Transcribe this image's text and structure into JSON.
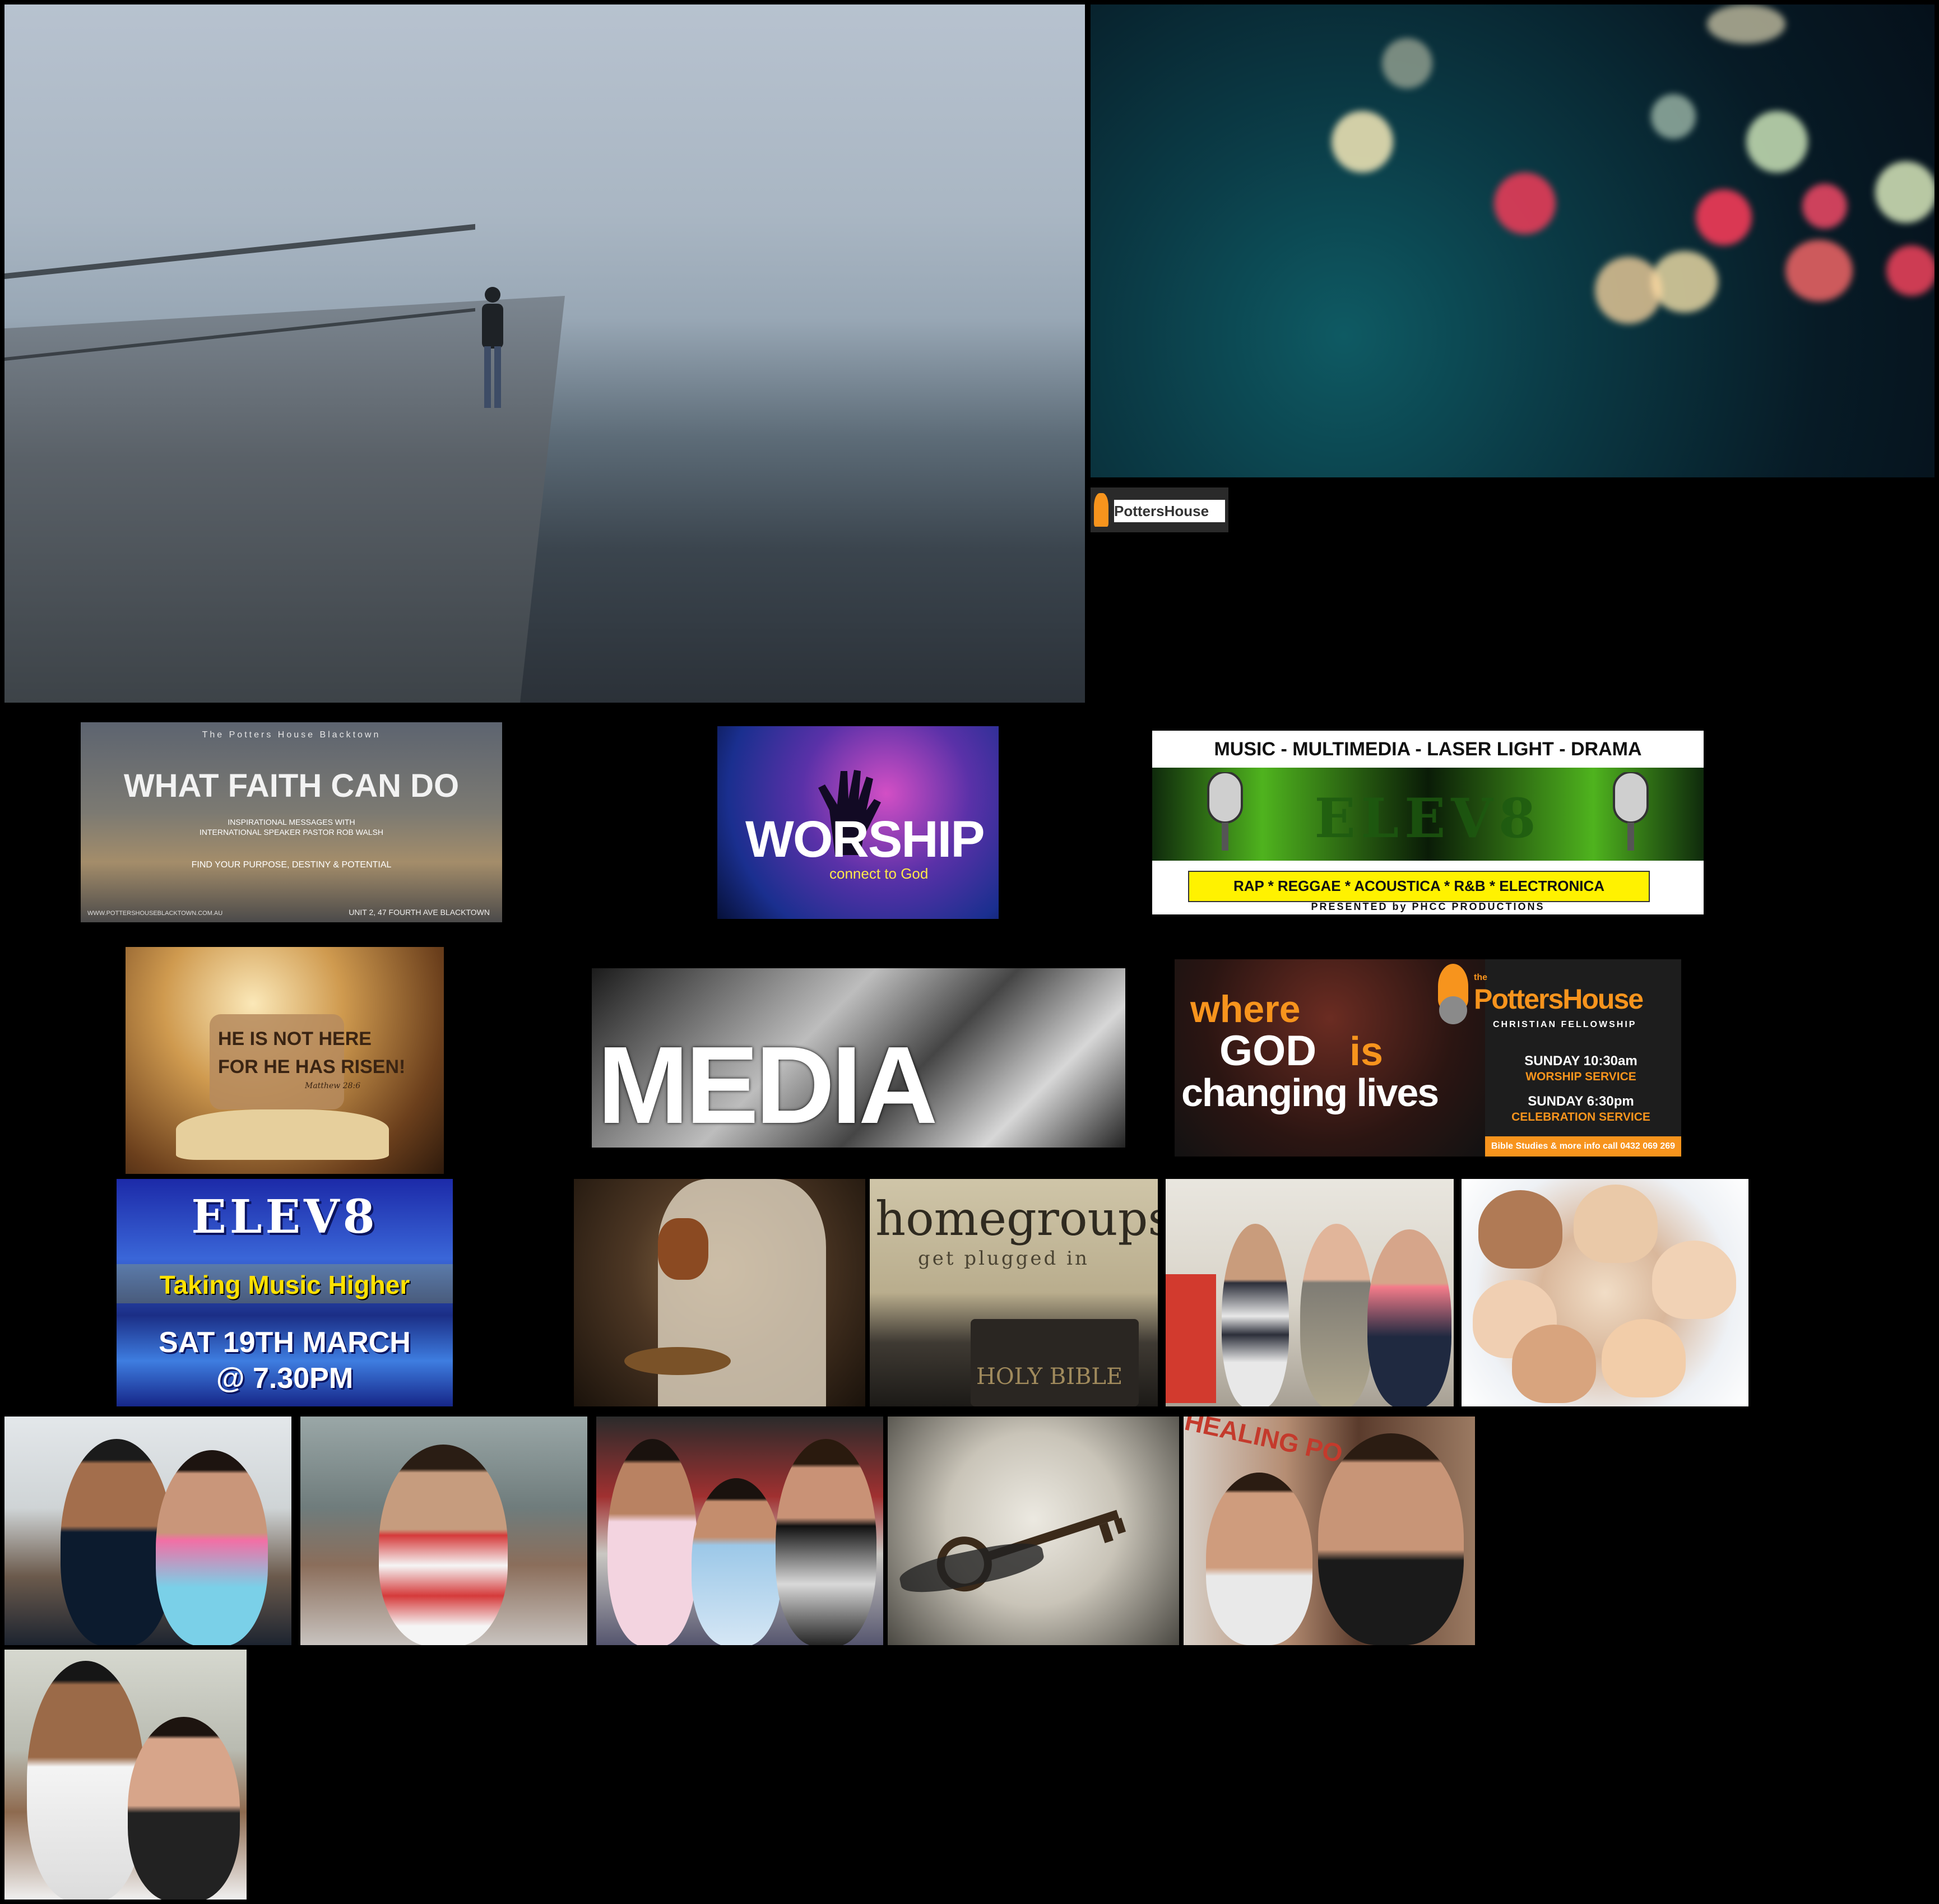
{
  "tiles": {
    "faith": {
      "kicker": "The Potters House Blacktown",
      "title": "WHAT FAITH CAN DO",
      "line1": "INSPIRATIONAL MESSAGES WITH",
      "line2": "INTERNATIONAL SPEAKER PASTOR ROB WALSH",
      "line3": "FIND YOUR PURPOSE, DESTINY & POTENTIAL",
      "url": "WWW.POTTERSHOUSEBLACKTOWN.COM.AU",
      "address": "UNIT 2, 47 FOURTH AVE BLACKTOWN"
    },
    "worship": {
      "title": "WORSHIP",
      "sub": "connect to God"
    },
    "elev8a": {
      "top": "MUSIC - MULTIMEDIA - LASER LIGHT - DRAMA",
      "band": "ELEV8",
      "genres": "RAP * REGGAE * ACOUSTICA * R&B * ELECTRONICA",
      "presented": "PRESENTED by PHCC PRODUCTIONS"
    },
    "risen": {
      "line1": "HE IS NOT HERE",
      "line2": "FOR HE HAS RISEN!",
      "ref": "Matthew 28:6"
    },
    "media": {
      "title": "MEDIA"
    },
    "godchange": {
      "w1": "where",
      "w2": "GOD",
      "w3": "is",
      "w4": "changing lives",
      "brand_small": "the",
      "brand": "PottersHouse",
      "brand_sub": "CHRISTIAN FELLOWSHIP",
      "s1": "SUNDAY 10:30am",
      "s1b": "WORSHIP SERVICE",
      "s2": "SUNDAY 6:30pm",
      "s2b": "CELEBRATION SERVICE",
      "footer": "Bible Studies & more info call 0432 069 269"
    },
    "elev8b": {
      "title": "ELEV8",
      "sub": "Taking Music Higher",
      "date": "SAT 19TH MARCH",
      "time": "@ 7.30PM"
    },
    "homegroups": {
      "title": "homegroups",
      "sub": "get plugged in",
      "book": "HOLY BIBLE"
    },
    "girls2": {
      "sign": "HEALING PO"
    },
    "smalllogo": {
      "brand": "PottersHouse"
    }
  },
  "colors": {
    "orange": "#f7941d",
    "green": "#4fb31e",
    "yellow": "#fff200"
  }
}
